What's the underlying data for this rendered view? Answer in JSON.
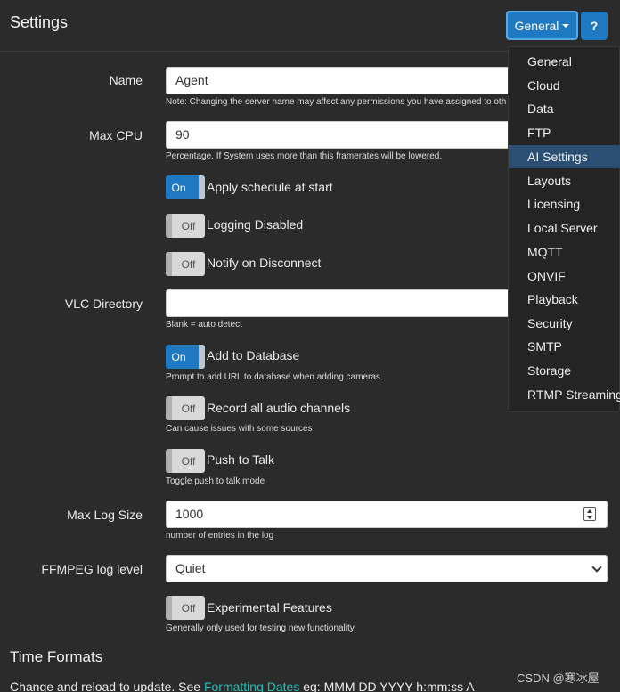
{
  "header": {
    "title": "Settings",
    "general_button": "General",
    "help_button": "?"
  },
  "fields": {
    "name": {
      "label": "Name",
      "value": "Agent",
      "help": "Note: Changing the server name may affect any permissions you have assigned to oth"
    },
    "max_cpu": {
      "label": "Max CPU",
      "value": "90",
      "help": "Percentage. If System uses more than this framerates will be lowered."
    },
    "vlc_directory": {
      "label": "VLC Directory",
      "value": "",
      "help": "Blank = auto detect"
    },
    "max_log_size": {
      "label": "Max Log Size",
      "value": "1000",
      "help": "number of entries in the log"
    },
    "ffmpeg_log_level": {
      "label": "FFMPEG log level",
      "value": "Quiet"
    }
  },
  "toggles": {
    "apply_schedule": {
      "state": "On",
      "label": "Apply schedule at start"
    },
    "logging": {
      "state": "Off",
      "label": "Logging Disabled"
    },
    "notify_disconnect": {
      "state": "Off",
      "label": "Notify on Disconnect"
    },
    "add_to_database": {
      "state": "On",
      "label": "Add to Database",
      "help": "Prompt to add URL to database when adding cameras"
    },
    "record_audio": {
      "state": "Off",
      "label": "Record all audio channels",
      "help": "Can cause issues with some sources"
    },
    "push_to_talk": {
      "state": "Off",
      "label": "Push to Talk",
      "help": "Toggle push to talk mode"
    },
    "experimental": {
      "state": "Off",
      "label": "Experimental Features",
      "help": "Generally only used for testing new functionality"
    }
  },
  "time_formats": {
    "title": "Time Formats",
    "text_before": "Change and reload to update. See ",
    "link": "Formatting Dates",
    "text_after": " eg: MMM DD YYYY h:mm:ss A"
  },
  "dropdown": {
    "items": [
      {
        "label": "General"
      },
      {
        "label": "Cloud"
      },
      {
        "label": "Data"
      },
      {
        "label": "FTP"
      },
      {
        "label": "AI Settings",
        "active": true
      },
      {
        "label": "Layouts"
      },
      {
        "label": "Licensing"
      },
      {
        "label": "Local Server"
      },
      {
        "label": "MQTT"
      },
      {
        "label": "ONVIF"
      },
      {
        "label": "Playback"
      },
      {
        "label": "Security"
      },
      {
        "label": "SMTP"
      },
      {
        "label": "Storage"
      },
      {
        "label": "RTMP Streaming"
      }
    ]
  },
  "watermark": "CSDN @寒冰屋",
  "colors": {
    "accent": "#1e78c2",
    "link": "#22c0b5",
    "background": "#2b2b2b"
  }
}
